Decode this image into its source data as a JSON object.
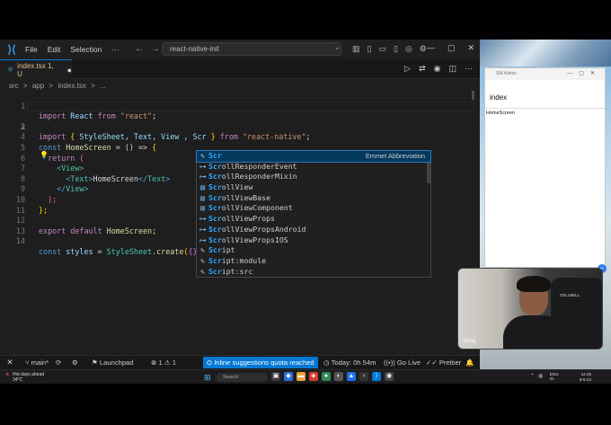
{
  "menu": {
    "file": "File",
    "edit": "Edit",
    "selection": "Selection"
  },
  "command_center": "react-native-init",
  "tab": {
    "label": "index.tsx 1, U",
    "icon": "typescript-react-icon",
    "dirty": "●"
  },
  "breadcrumb": [
    "src",
    ">",
    "app",
    ">",
    "index.tsx",
    ">",
    "..."
  ],
  "code_lines": [
    {
      "n": "1"
    },
    {
      "n": "2"
    },
    {
      "n": "3"
    },
    {
      "n": "4"
    },
    {
      "n": "5"
    },
    {
      "n": "6"
    },
    {
      "n": "7"
    },
    {
      "n": "8"
    },
    {
      "n": "9"
    },
    {
      "n": "10"
    },
    {
      "n": "11"
    },
    {
      "n": "12"
    },
    {
      "n": "13"
    },
    {
      "n": "14"
    }
  ],
  "code": {
    "l1": {
      "a": "import",
      "b": " React ",
      "c": "from",
      "d": " \"react\"",
      "e": ";"
    },
    "l2": {
      "a": "import",
      "b": " { ",
      "c": "StyleSheet, Text, View , Scr",
      "d": " } ",
      "e": "from",
      "f": " \"react-native\"",
      "g": ";"
    },
    "l4": {
      "a": "const",
      "b": " HomeScreen",
      "c": " = () => ",
      "d": "{"
    },
    "l5": {
      "a": "return",
      "b": " ("
    },
    "l6": {
      "a": "<",
      "b": "View",
      "c": ">"
    },
    "l7": {
      "a": "<",
      "b": "Text",
      "c": ">",
      "d": "HomeScreen",
      "e": "</",
      "f": "Text",
      "g": ">"
    },
    "l8": {
      "a": "</",
      "b": "View",
      "c": ">"
    },
    "l9": {
      "a": ");"
    },
    "l10": {
      "a": "};"
    },
    "l12": {
      "a": "export",
      "b": " ",
      "c": "default",
      "d": " HomeScreen;"
    },
    "l14": {
      "a": "const",
      "b": " styles",
      "c": " = ",
      "d": "StyleSheet",
      "e": ".",
      "f": "create",
      "g": "(",
      "h": "{}",
      "i": ");"
    }
  },
  "suggestions": {
    "items": [
      {
        "match": "Scr",
        "rest": "",
        "icon": "snippet-icon",
        "detail": "Emmet Abbreviation"
      },
      {
        "match": "Scr",
        "rest": "ollResponderEvent",
        "icon": "interface-icon"
      },
      {
        "match": "Scr",
        "rest": "ollResponderMixin",
        "icon": "interface-icon"
      },
      {
        "match": "Scr",
        "rest": "ollView",
        "icon": "class-icon"
      },
      {
        "match": "Scr",
        "rest": "ollViewBase",
        "icon": "class-icon"
      },
      {
        "match": "Scr",
        "rest": "ollViewComponent",
        "icon": "class-icon"
      },
      {
        "match": "Scr",
        "rest": "ollViewProps",
        "icon": "interface-icon"
      },
      {
        "match": "Scr",
        "rest": "ollViewPropsAndroid",
        "icon": "interface-icon"
      },
      {
        "match": "Scr",
        "rest": "ollViewPropsIOS",
        "icon": "interface-icon"
      },
      {
        "match": "Scr",
        "rest": "ipt",
        "icon": "snippet-icon"
      },
      {
        "match": "Scr",
        "rest": "ipt:module",
        "icon": "snippet-icon"
      },
      {
        "match": "Scr",
        "rest": "ipt:src",
        "icon": "snippet-icon"
      }
    ]
  },
  "status": {
    "branch": "main*",
    "launchpad": "Launchpad",
    "errors": "1",
    "warnings": "1",
    "quota": "Inline suggestions quota reached",
    "today": "Today: 0h 54m",
    "golive": "Go Live",
    "prettier": "Prettier"
  },
  "preview": {
    "window_title": "SM Admin",
    "header": "index",
    "body": "HomeScreen"
  },
  "webcam": {
    "name": "Suraj",
    "brand": "CELLBELL"
  },
  "taskbar": {
    "weather_line1": "Hot days ahead",
    "weather_line2": "34°C",
    "search": "Search",
    "lang1": "ENG",
    "lang2": "IN",
    "time": "12:45",
    "date": "9-5-24"
  },
  "colors": {
    "accent": "#0078d4",
    "editor_bg": "#1e1e1e",
    "selection": "#04395e",
    "match": "#2aaaff"
  }
}
